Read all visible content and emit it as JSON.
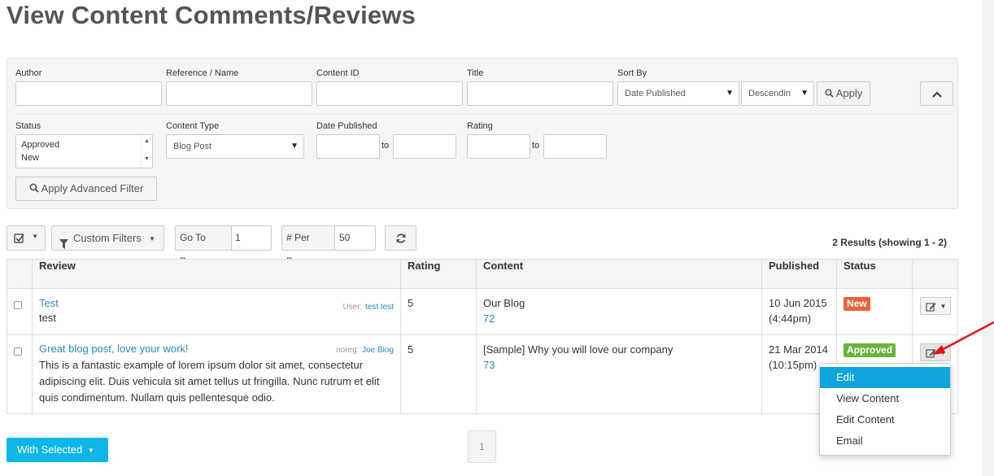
{
  "page": {
    "title": "View Content Comments/Reviews"
  },
  "filters": {
    "author_label": "Author",
    "reference_label": "Reference / Name",
    "content_id_label": "Content ID",
    "title_label": "Title",
    "sort_by_label": "Sort By",
    "sort_by_value": "Date Published",
    "sort_order_value": "Descendin",
    "apply_label": "Apply",
    "status_label": "Status",
    "status_options": [
      "Approved",
      "New"
    ],
    "content_type_label": "Content Type",
    "content_type_value": "Blog Post",
    "date_published_label": "Date Published",
    "to_label": "to",
    "rating_label": "Rating",
    "apply_advanced_label": "Apply Advanced Filter"
  },
  "toolbar": {
    "custom_filters_label": "Custom Filters",
    "go_to_page_label": "Go To Page",
    "go_to_page_value": "1",
    "per_page_label": "# Per Page",
    "per_page_value": "50",
    "results_text": "2 Results (showing 1 - 2)"
  },
  "table": {
    "headers": [
      "Review",
      "Rating",
      "Content",
      "Published",
      "Status"
    ],
    "rows": [
      {
        "review_title": "Test",
        "review_body": "test",
        "user_prefix": "User:",
        "user_name": "test test",
        "rating": "5",
        "content_title": "Our Blog",
        "content_id": "72",
        "published_date": "10 Jun 2015",
        "published_time": "(4:44pm)",
        "status": "New",
        "status_color": "#e8643c"
      },
      {
        "review_title": "Great blog post, love your work!",
        "review_body": "This is a fantastic example of lorem ipsum dolor sit amet, consectetur adipiscing elit. Duis vehicula sit amet tellus ut fringilla. Nunc rutrum et elit quis condimentum. Nullam quis pellentesque odio.",
        "user_prefix": "noreg:",
        "user_name": "Joe Blog",
        "rating": "5",
        "content_title": "[Sample] Why you will love our company",
        "content_id": "73",
        "published_date": "21 Mar 2014",
        "published_time": "(10:15pm)",
        "status": "Approved",
        "status_color": "#6ab43e"
      }
    ]
  },
  "row_menu": {
    "items": [
      "Edit",
      "View Content",
      "Edit Content",
      "Email"
    ]
  },
  "footer": {
    "with_selected_label": "With Selected",
    "page_number": "1"
  },
  "colors": {
    "accent": "#0fb5e6",
    "link": "#2a8ab8",
    "arrow": "#e0141e"
  }
}
